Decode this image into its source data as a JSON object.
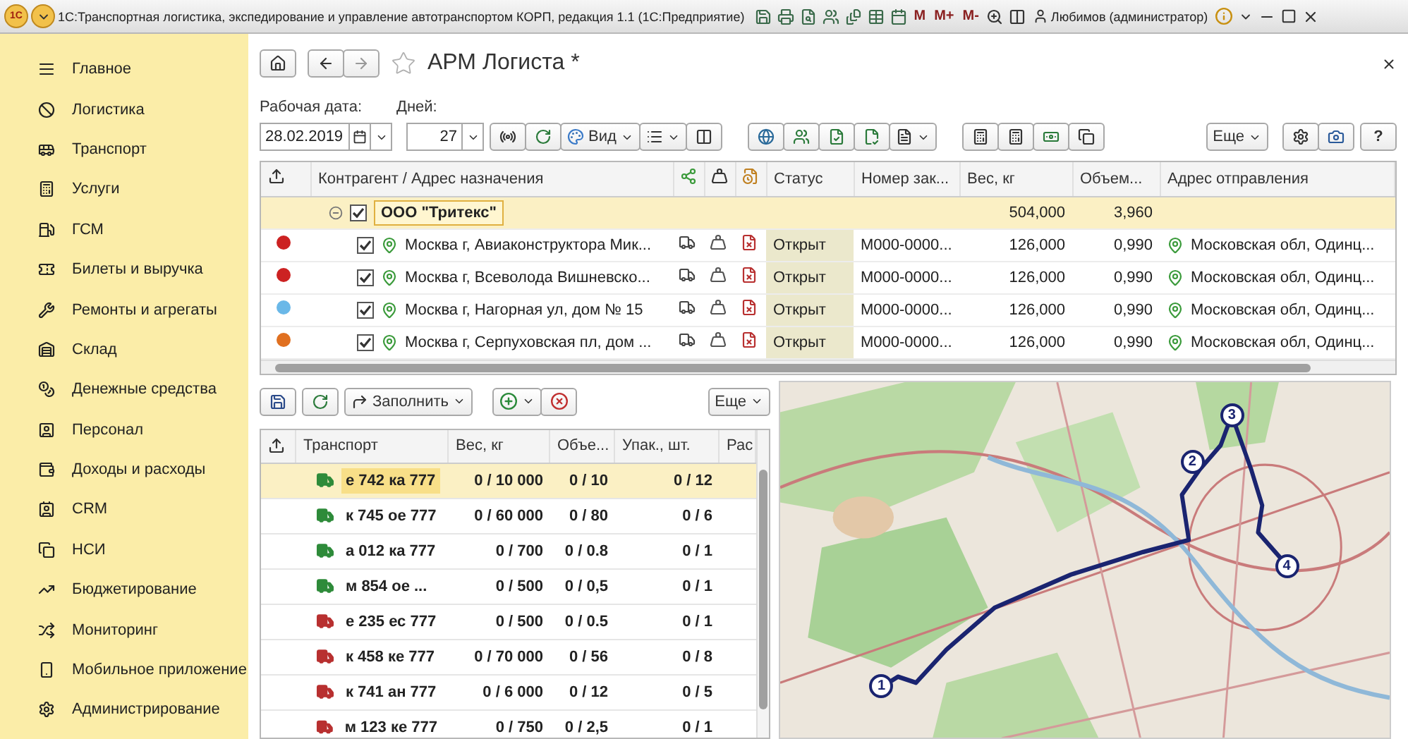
{
  "window": {
    "logo": "1С",
    "title": "1С:Транспортная логистика, экспедирование и управление автотранспортом КОРП, редакция 1.1  (1С:Предприятие)",
    "memory_buttons": [
      "M",
      "M+",
      "M-"
    ],
    "user": "Любимов (администратор)"
  },
  "sidebar": {
    "items": [
      {
        "label": "Главное"
      },
      {
        "label": "Логистика"
      },
      {
        "label": "Транспорт"
      },
      {
        "label": "Услуги"
      },
      {
        "label": "ГСМ"
      },
      {
        "label": "Билеты и выручка"
      },
      {
        "label": "Ремонты и агрегаты"
      },
      {
        "label": "Склад"
      },
      {
        "label": "Денежные средства"
      },
      {
        "label": "Персонал"
      },
      {
        "label": "Доходы и расходы"
      },
      {
        "label": "CRM"
      },
      {
        "label": "НСИ"
      },
      {
        "label": "Бюджетирование"
      },
      {
        "label": "Мониторинг"
      },
      {
        "label": "Мобильное приложение"
      },
      {
        "label": "Администрирование"
      }
    ]
  },
  "page": {
    "title": "АРМ Логиста *"
  },
  "filters": {
    "date_label": "Рабочая дата:",
    "date": "28.02.2019",
    "days_label": "Дней:",
    "days": "27"
  },
  "toolbar": {
    "view_button": "Вид",
    "more_button": "Еще",
    "help_button": "?"
  },
  "orders": {
    "columns": [
      "Контрагент / Адрес назначения",
      "Статус",
      "Номер зак...",
      "Вес, кг",
      "Объем...",
      "Адрес отправления"
    ],
    "group": {
      "name": "ООО \"Тритекс\"",
      "checked": true,
      "expanded": true,
      "weight": "504,000",
      "volume": "3,960"
    },
    "rows": [
      {
        "color": "#cc2222",
        "checked": true,
        "address": "Москва г, Авиаконструктора Мик...",
        "status": "Открыт",
        "number": "М000-0000...",
        "weight": "126,000",
        "volume": "0,990",
        "origin": "Московская обл, Одинц..."
      },
      {
        "color": "#cc2222",
        "checked": true,
        "address": "Москва г, Всеволода Вишневско...",
        "status": "Открыт",
        "number": "М000-0000...",
        "weight": "126,000",
        "volume": "0,990",
        "origin": "Московская обл, Одинц..."
      },
      {
        "color": "#6ab8e8",
        "checked": true,
        "address": "Москва г, Нагорная ул, дом № 15",
        "status": "Открыт",
        "number": "М000-0000...",
        "weight": "126,000",
        "volume": "0,990",
        "origin": "Московская обл, Одинц..."
      },
      {
        "color": "#e07020",
        "checked": true,
        "address": "Москва г, Серпуховская пл, дом ...",
        "status": "Открыт",
        "number": "М000-0000...",
        "weight": "126,000",
        "volume": "0,990",
        "origin": "Московская обл, Одинц..."
      }
    ]
  },
  "transport": {
    "fill_button": "Заполнить",
    "more_button": "Еще",
    "columns": [
      "Транспорт",
      "Вес, кг",
      "Объе...",
      "Упак., шт.",
      "Рас"
    ],
    "rows": [
      {
        "plate": "е 742 ка 777",
        "weight": "0 / 10 000",
        "volume": "0 / 10",
        "packages": "0 / 12",
        "color": "#2e8b3a",
        "selected": true
      },
      {
        "plate": "к 745 ое 777",
        "weight": "0 / 60 000",
        "volume": "0 / 80",
        "packages": "0 / 6",
        "color": "#2e8b3a",
        "selected": false
      },
      {
        "plate": "а 012 ка 777",
        "weight": "0 / 700",
        "volume": "0 / 0.8",
        "packages": "0 / 1",
        "color": "#2e8b3a",
        "selected": false
      },
      {
        "plate": "м 854 ое ...",
        "weight": "0 / 500",
        "volume": "0 / 0,5",
        "packages": "0 / 1",
        "color": "#2e8b3a",
        "selected": false
      },
      {
        "plate": "е 235 ес 777",
        "weight": "0 / 500",
        "volume": "0 / 0.5",
        "packages": "0 / 1",
        "color": "#b83030",
        "selected": false
      },
      {
        "plate": "к 458 ке 777",
        "weight": "0 / 70 000",
        "volume": "0 / 56",
        "packages": "0 / 8",
        "color": "#b83030",
        "selected": false
      },
      {
        "plate": "к 741 ан 777",
        "weight": "0 / 6 000",
        "volume": "0 / 12",
        "packages": "0 / 5",
        "color": "#b83030",
        "selected": false
      },
      {
        "plate": "м 123 ке 777",
        "weight": "0 / 750",
        "volume": "0 / 2,5",
        "packages": "0 / 1",
        "color": "#b83030",
        "selected": false
      }
    ]
  },
  "map": {
    "kind": "picture",
    "route_points": [
      "1",
      "2",
      "3",
      "4"
    ]
  }
}
